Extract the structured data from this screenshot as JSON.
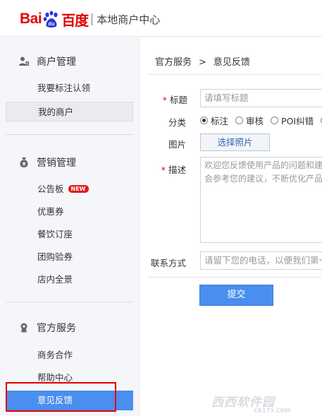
{
  "header": {
    "logo_bai": "Bai",
    "logo_paw": "du",
    "logo_du": "百度",
    "subtitle": "本地商户中心"
  },
  "sidebar": {
    "sections": [
      {
        "title": "商户管理",
        "icon": "merchant-icon"
      },
      {
        "title": "营销管理",
        "icon": "money-bag-icon"
      },
      {
        "title": "官方服务",
        "icon": "ribbon-icon"
      }
    ],
    "merchant_items": [
      {
        "label": "我要标注认领"
      },
      {
        "label": "我的商户"
      }
    ],
    "marketing_items": [
      {
        "label": "公告板",
        "badge": "NEW"
      },
      {
        "label": "优惠券"
      },
      {
        "label": "餐饮订座"
      },
      {
        "label": "团购验券"
      },
      {
        "label": "店内全景"
      }
    ],
    "service_items": [
      {
        "label": "商务合作"
      },
      {
        "label": "帮助中心"
      },
      {
        "label": "意见反馈"
      }
    ]
  },
  "breadcrumb": {
    "parent": "官方服务",
    "arrow": ">",
    "current": "意见反馈"
  },
  "form": {
    "title_label": "标题",
    "title_placeholder": "请填写标题",
    "category_label": "分类",
    "categories": [
      {
        "label": "标注",
        "selected": true
      },
      {
        "label": "审核",
        "selected": false
      },
      {
        "label": "POI纠错",
        "selected": false
      }
    ],
    "image_label": "图片",
    "image_button": "选择照片",
    "desc_label": "描述",
    "desc_placeholder_line1": "欢迎您反馈使用产品的问题和建",
    "desc_placeholder_line2": "会参考您的建议，不断优化产品",
    "contact_label": "联系方式",
    "contact_placeholder": "请留下您的电话，以便我们第一",
    "required_mark": "*",
    "submit": "提交"
  },
  "watermark": {
    "text": "西西软件园",
    "sub": "CR173.COM"
  },
  "colors": {
    "brand_red": "#e10602",
    "accent_blue": "#4a8ef0",
    "sidebar_bg": "#f5f6fa",
    "highlight_box": "#e00000"
  }
}
